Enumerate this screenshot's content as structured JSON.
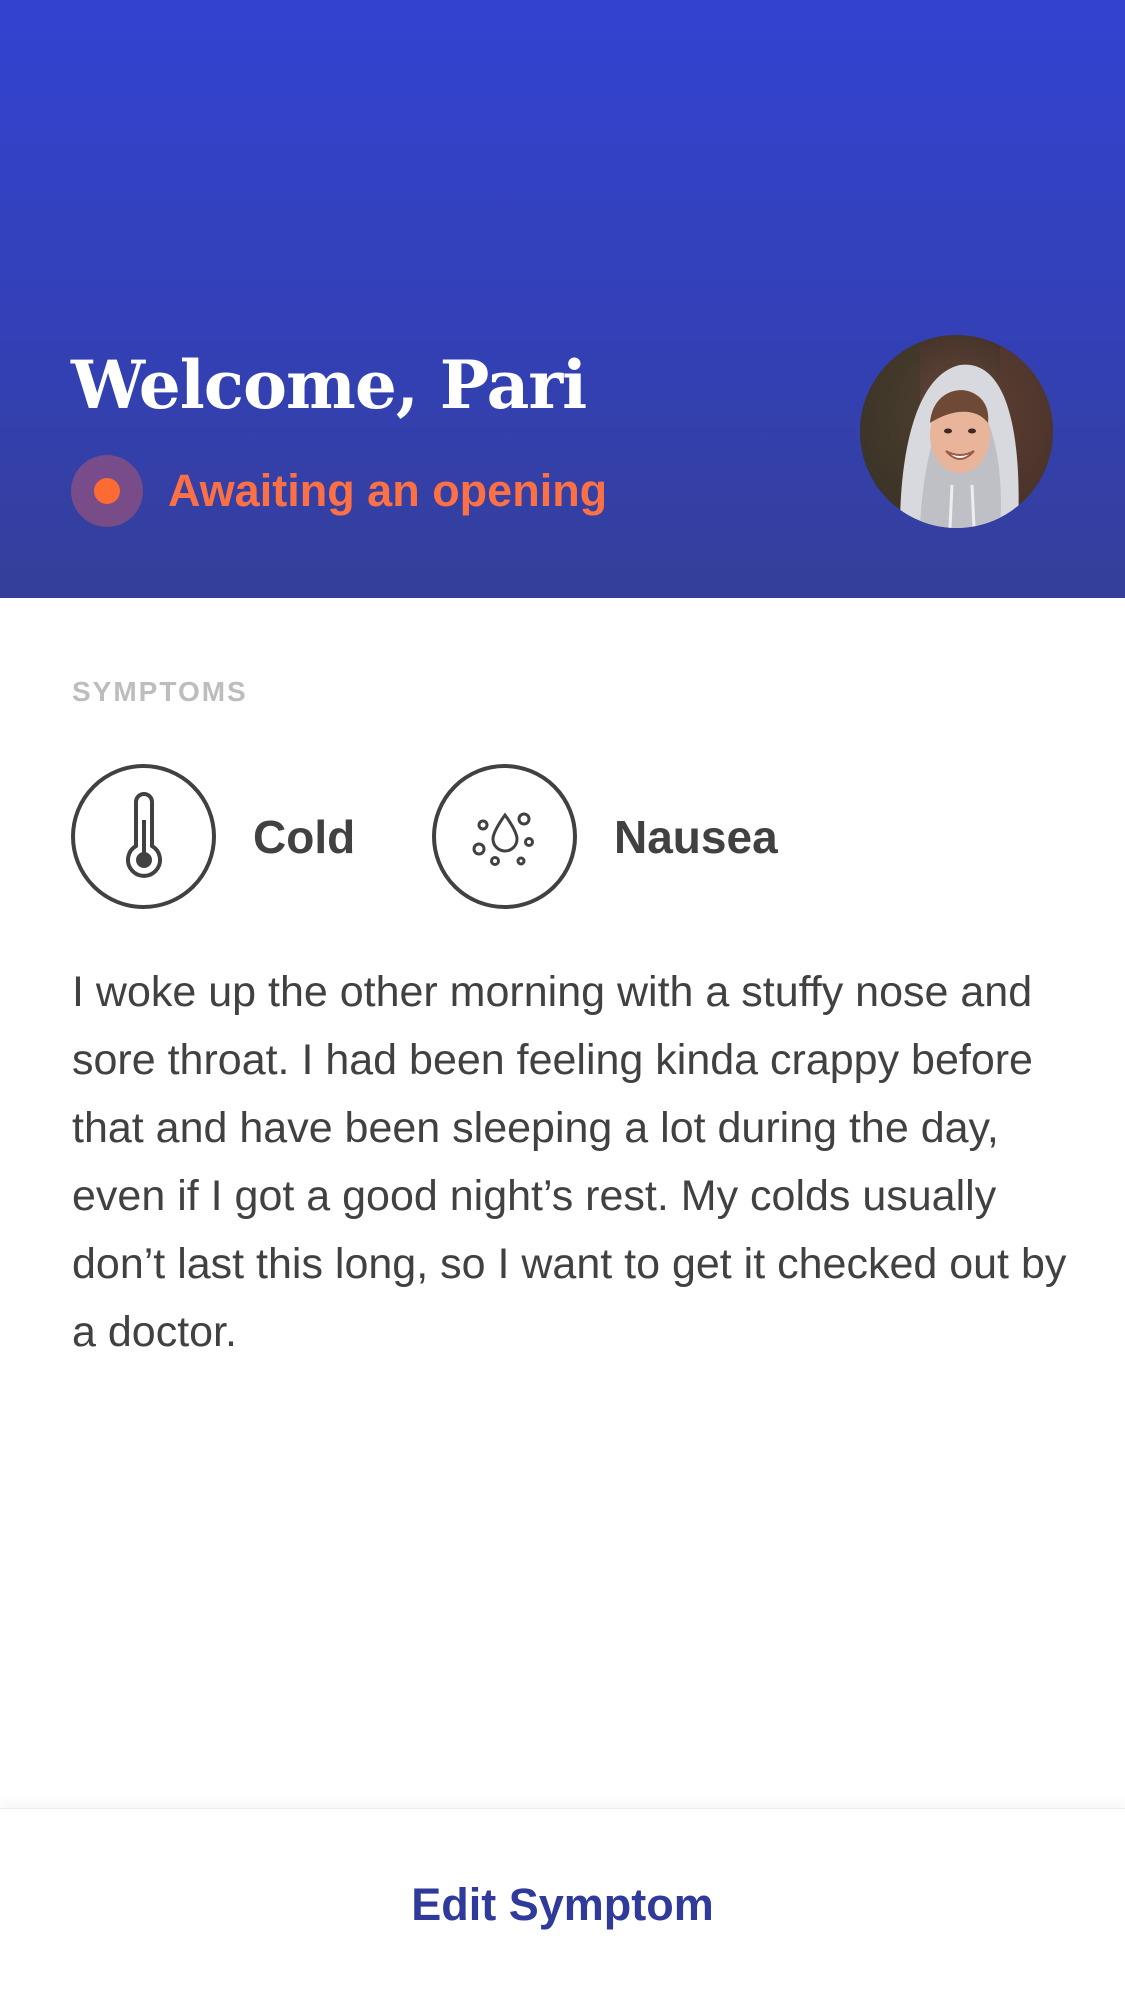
{
  "header": {
    "welcome": "Welcome, Pari",
    "status_text": "Awaiting an opening",
    "status_color": "#fb6b33",
    "background_color": "#3343d1"
  },
  "symptoms": {
    "section_label": "SYMPTOMS",
    "items": [
      {
        "label": "Cold",
        "icon": "thermometer-icon"
      },
      {
        "label": "Nausea",
        "icon": "droplets-icon"
      }
    ],
    "description": "I woke up the other morning with a stuffy nose and sore throat. I had been feeling kinda crappy before that and have been sleeping a lot during the day, even if I got a good night’s rest. My colds usually don’t last this long, so I want to get it checked out by a doctor."
  },
  "footer": {
    "edit_label": "Edit Symptom",
    "accent_color": "#2f3a9b"
  }
}
